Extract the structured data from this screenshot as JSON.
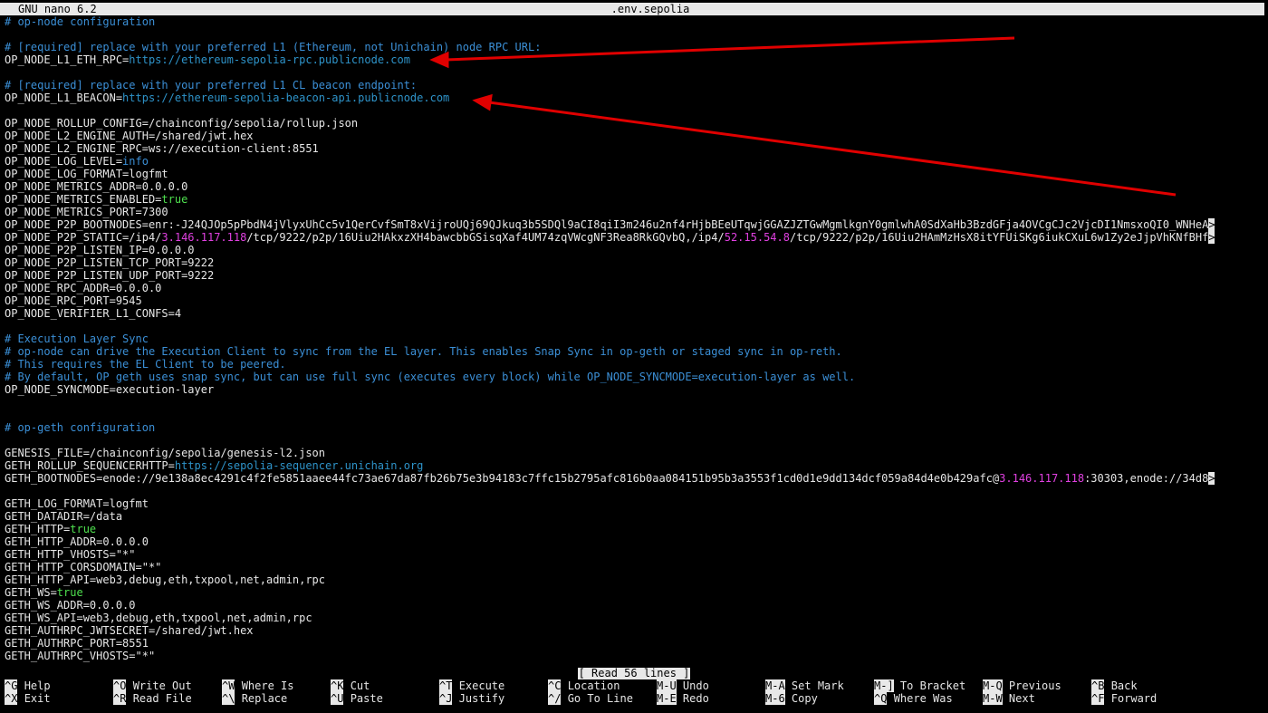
{
  "titlebar": {
    "app": "GNU nano 6.2",
    "file": ".env.sepolia"
  },
  "lines": [
    [
      {
        "c": "c",
        "t": "# op-node configuration"
      }
    ],
    [],
    [
      {
        "c": "c",
        "t": "# [required] replace with your preferred L1 (Ethereum, not Unichain) node RPC URL:"
      }
    ],
    [
      {
        "t": "OP_NODE_L1_ETH_RPC="
      },
      {
        "c": "u",
        "t": "https://ethereum-sepolia-rpc.publicnode.com"
      }
    ],
    [],
    [
      {
        "c": "c",
        "t": "# [required] replace with your preferred L1 CL beacon endpoint:"
      }
    ],
    [
      {
        "t": "OP_NODE_L1_BEACON="
      },
      {
        "c": "u",
        "t": "https://ethereum-sepolia-beacon-api.publicnode.com"
      }
    ],
    [],
    [
      {
        "t": "OP_NODE_ROLLUP_CONFIG=/chainconfig/sepolia/rollup.json"
      }
    ],
    [
      {
        "t": "OP_NODE_L2_ENGINE_AUTH=/shared/jwt.hex"
      }
    ],
    [
      {
        "t": "OP_NODE_L2_ENGINE_RPC=ws://execution-client:8551"
      }
    ],
    [
      {
        "t": "OP_NODE_LOG_LEVEL="
      },
      {
        "c": "c",
        "t": "info"
      }
    ],
    [
      {
        "t": "OP_NODE_LOG_FORMAT=logfmt"
      }
    ],
    [
      {
        "t": "OP_NODE_METRICS_ADDR=0.0.0.0"
      }
    ],
    [
      {
        "t": "OP_NODE_METRICS_ENABLED="
      },
      {
        "c": "g",
        "t": "true"
      }
    ],
    [
      {
        "t": "OP_NODE_METRICS_PORT=7300"
      }
    ],
    [
      {
        "t": "OP_NODE_P2P_BOOTNODES=enr:-J24QJOp5pPbdN4jVlyxUhCc5v1QerCvfSmT8xVijroUQj69QJkuq3b5SDQl9aCI8qiI3m246u2nf4rHjbBEeUTqwjGGAZJZTGwMgmlkgnY0gmlwhA0SdXaHb3BzdGFja4OVCgCJc2VjcDI1NmsxoQI0_WNHeA"
      },
      {
        "c": "ov",
        "t": ">"
      }
    ],
    [
      {
        "t": "OP_NODE_P2P_STATIC=/ip4/"
      },
      {
        "c": "m",
        "t": "3.146.117.118"
      },
      {
        "t": "/tcp/9222/p2p/16Uiu2HAkxzXH4bawcbbGSisqXaf4UM74zqVWcgNF3Rea8RkGQvbQ,/ip4/"
      },
      {
        "c": "m",
        "t": "52.15.54.8"
      },
      {
        "t": "/tcp/9222/p2p/16Uiu2HAmMzHsX8itYFUiSKg6iukCXuL6w1Zy2eJjpVhKNfBHf"
      },
      {
        "c": "ov",
        "t": ">"
      }
    ],
    [
      {
        "t": "OP_NODE_P2P_LISTEN_IP=0.0.0.0"
      }
    ],
    [
      {
        "t": "OP_NODE_P2P_LISTEN_TCP_PORT=9222"
      }
    ],
    [
      {
        "t": "OP_NODE_P2P_LISTEN_UDP_PORT=9222"
      }
    ],
    [
      {
        "t": "OP_NODE_RPC_ADDR=0.0.0.0"
      }
    ],
    [
      {
        "t": "OP_NODE_RPC_PORT=9545"
      }
    ],
    [
      {
        "t": "OP_NODE_VERIFIER_L1_CONFS=4"
      }
    ],
    [],
    [
      {
        "c": "c",
        "t": "# Execution Layer Sync"
      }
    ],
    [
      {
        "c": "c",
        "t": "# op-node can drive the Execution Client to sync from the EL layer. This enables Snap Sync in op-geth or staged sync in op-reth."
      }
    ],
    [
      {
        "c": "c",
        "t": "# This requires the EL Client to be peered."
      }
    ],
    [
      {
        "c": "c",
        "t": "# By default, OP geth uses snap sync, but can use full sync (executes every block) while OP_NODE_SYNCMODE=execution-layer as well."
      }
    ],
    [
      {
        "t": "OP_NODE_SYNCMODE=execution-layer"
      }
    ],
    [],
    [],
    [
      {
        "c": "c",
        "t": "# op-geth configuration"
      }
    ],
    [],
    [
      {
        "t": "GENESIS_FILE=/chainconfig/sepolia/genesis-l2.json"
      }
    ],
    [
      {
        "t": "GETH_ROLLUP_SEQUENCERHTTP="
      },
      {
        "c": "u",
        "t": "https://sepolia-sequencer.unichain.org"
      }
    ],
    [
      {
        "t": "GETH_BOOTNODES=enode://9e138a8ec4291c4f2fe5851aaee44fc73ae67da87fb26b75e3b94183c7ffc15b2795afc816b0aa084151b95b3a3553f1cd0d1e9dd134dcf059a84d4e0b429afc@"
      },
      {
        "c": "m",
        "t": "3.146.117.118"
      },
      {
        "t": ":30303,enode://34d8"
      },
      {
        "c": "ov",
        "t": ">"
      }
    ],
    [],
    [
      {
        "t": "GETH_LOG_FORMAT=logfmt"
      }
    ],
    [
      {
        "t": "GETH_DATADIR=/data"
      }
    ],
    [
      {
        "t": "GETH_HTTP="
      },
      {
        "c": "g",
        "t": "true"
      }
    ],
    [
      {
        "t": "GETH_HTTP_ADDR=0.0.0.0"
      }
    ],
    [
      {
        "t": "GETH_HTTP_VHOSTS=\"*\""
      }
    ],
    [
      {
        "t": "GETH_HTTP_CORSDOMAIN=\"*\""
      }
    ],
    [
      {
        "t": "GETH_HTTP_API=web3,debug,eth,txpool,net,admin,rpc"
      }
    ],
    [
      {
        "t": "GETH_WS="
      },
      {
        "c": "g",
        "t": "true"
      }
    ],
    [
      {
        "t": "GETH_WS_ADDR=0.0.0.0"
      }
    ],
    [
      {
        "t": "GETH_WS_API=web3,debug,eth,txpool,net,admin,rpc"
      }
    ],
    [
      {
        "t": "GETH_AUTHRPC_JWTSECRET=/shared/jwt.hex"
      }
    ],
    [
      {
        "t": "GETH_AUTHRPC_PORT=8551"
      }
    ],
    [
      {
        "t": "GETH_AUTHRPC_VHOSTS=\"*\""
      }
    ]
  ],
  "status": "[ Read 56 lines ]",
  "shortcuts": [
    {
      "key": "^G",
      "label": "Help"
    },
    {
      "key": "^X",
      "label": "Exit"
    },
    {
      "key": "^O",
      "label": "Write Out"
    },
    {
      "key": "^R",
      "label": "Read File"
    },
    {
      "key": "^W",
      "label": "Where Is"
    },
    {
      "key": "^\\",
      "label": "Replace"
    },
    {
      "key": "^K",
      "label": "Cut"
    },
    {
      "key": "^U",
      "label": "Paste"
    },
    {
      "key": "^T",
      "label": "Execute"
    },
    {
      "key": "^J",
      "label": "Justify"
    },
    {
      "key": "^C",
      "label": "Location"
    },
    {
      "key": "^/",
      "label": "Go To Line"
    },
    {
      "key": "M-U",
      "label": "Undo"
    },
    {
      "key": "M-E",
      "label": "Redo"
    },
    {
      "key": "M-A",
      "label": "Set Mark"
    },
    {
      "key": "M-6",
      "label": "Copy"
    },
    {
      "key": "M-]",
      "label": "To Bracket"
    },
    {
      "key": "^Q",
      "label": "Where Was"
    },
    {
      "key": "M-Q",
      "label": "Previous"
    },
    {
      "key": "M-W",
      "label": "Next"
    },
    {
      "key": "^B",
      "label": "Back"
    },
    {
      "key": "^F",
      "label": "Forward"
    }
  ],
  "colors": {
    "comment": "#3b8fd6",
    "url": "#2e93c9",
    "boolean": "#4ee04e",
    "ip": "#e040e0",
    "annotation_arrow": "#e00000"
  }
}
